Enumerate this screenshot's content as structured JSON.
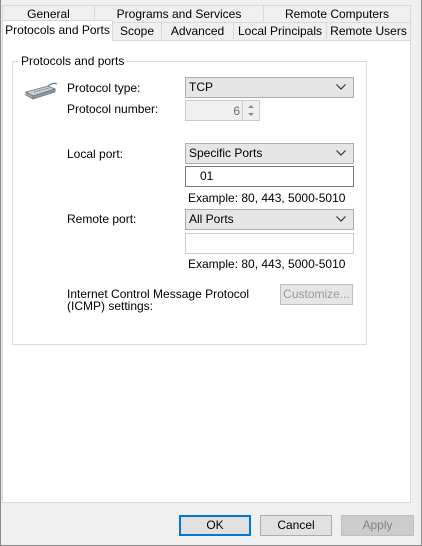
{
  "tabs": {
    "row1": [
      "General",
      "Programs and Services",
      "Remote Computers"
    ],
    "row2": [
      "Protocols and Ports",
      "Scope",
      "Advanced",
      "Local Principals",
      "Remote Users"
    ],
    "active": "Protocols and Ports"
  },
  "group": {
    "title": "Protocols and ports"
  },
  "protocol": {
    "type_label": "Protocol type:",
    "type_value": "TCP",
    "number_label": "Protocol number:",
    "number_value": "6"
  },
  "local_port": {
    "label": "Local port:",
    "selected": "Specific Ports",
    "input_value": "01",
    "example": "Example: 80, 443, 5000-5010"
  },
  "remote_port": {
    "label": "Remote port:",
    "selected": "All Ports",
    "input_value": "",
    "example": "Example: 80, 443, 5000-5010"
  },
  "icmp": {
    "label_line1": "Internet Control Message Protocol",
    "label_line2": "(ICMP) settings:",
    "button": "Customize..."
  },
  "footer": {
    "ok": "OK",
    "cancel": "Cancel",
    "apply": "Apply"
  },
  "colors": {
    "accent": "#0078d7",
    "window_bg": "#f0f0f0",
    "panel_bg": "#ffffff"
  }
}
